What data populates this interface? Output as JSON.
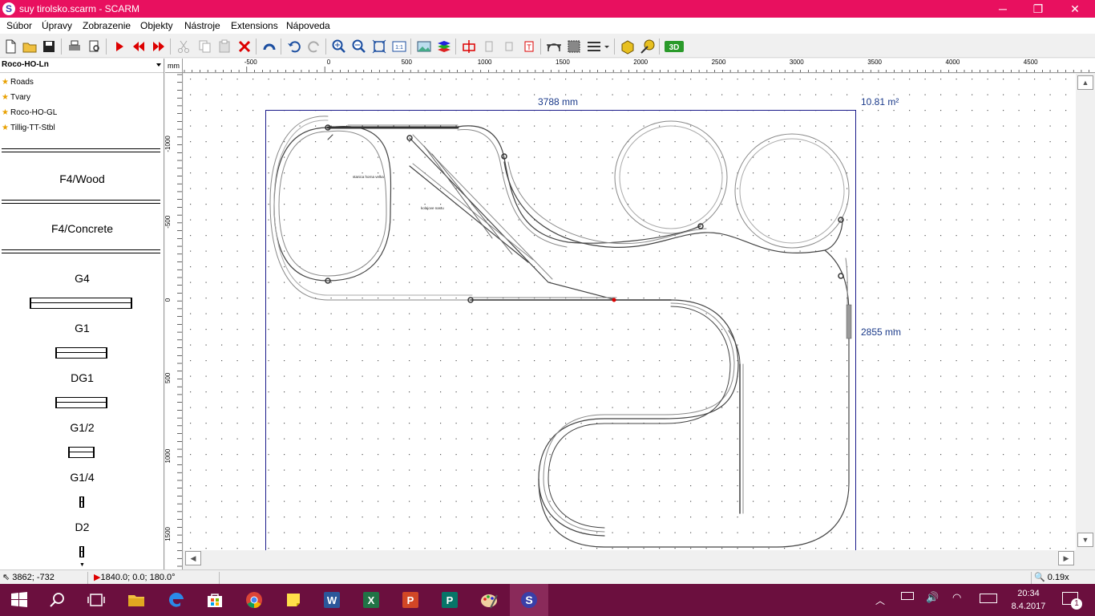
{
  "window": {
    "title": "suy tirolsko.scarm - SCARM",
    "app_icon_letter": "S",
    "controls": {
      "minimize": "─",
      "maximize": "❐",
      "close": "✕"
    }
  },
  "menu": [
    "Súbor",
    "Úpravy",
    "Zobrazenie",
    "Objekty",
    "Nástroje",
    "Extensions",
    "Nápoveda"
  ],
  "toolbar_icons": [
    "new-file-icon",
    "open-folder-icon",
    "save-icon",
    "print-icon",
    "print-preview-icon",
    "run-icon",
    "rewind-icon",
    "forward-icon",
    "cut-icon",
    "copy-icon",
    "paste-icon",
    "delete-icon",
    "rotate-icon",
    "undo-icon",
    "redo-icon",
    "zoom-in-icon",
    "zoom-out-icon",
    "zoom-fit-icon",
    "zoom-1to1-icon",
    "background-image-icon",
    "layers-icon",
    "elevation-icon",
    "flex-track-icon",
    "flex-track2-icon",
    "marker-icon",
    "bridge-icon",
    "tunnel-icon",
    "ruler-list-icon",
    "measure-icon",
    "tape-icon",
    "3d-view-icon"
  ],
  "toolbar_3d_label": "3D",
  "library": {
    "selected": "Roco-HO-Ln",
    "favorites": [
      "Roads",
      "Tvary",
      "Roco-HO-GL",
      "Tillig-TT-Stbl"
    ],
    "tracks": [
      {
        "label": "F4/Wood"
      },
      {
        "label": "F4/Concrete"
      },
      {
        "label": "G4"
      },
      {
        "label": "G1"
      },
      {
        "label": "DG1"
      },
      {
        "label": "G1/2"
      },
      {
        "label": "G1/4"
      },
      {
        "label": "D2"
      }
    ]
  },
  "ruler": {
    "unit": "mm",
    "h_ticks": [
      "-500",
      "0",
      "500",
      "1000",
      "1500",
      "2000",
      "2500",
      "3000",
      "3500",
      "4000",
      "4500"
    ],
    "v_ticks": [
      "-1000",
      "-500",
      "0",
      "500",
      "1000",
      "1500"
    ]
  },
  "board": {
    "width_label": "3788 mm",
    "height_label": "2855 mm",
    "area_label": "10.81 m²"
  },
  "layout_text": {
    "label_a": "stanica horna velka",
    "label_b": "kolajove nastu"
  },
  "status": {
    "cursor": "3862; -732",
    "selection": "1840.0; 0.0; 180.0°",
    "zoom": "0.19x"
  },
  "taskbar": {
    "apps": [
      "windows-start-icon",
      "search-icon",
      "task-view-icon",
      "file-explorer-icon",
      "edge-icon",
      "store-icon",
      "chrome-icon",
      "sticky-notes-icon",
      "word-icon",
      "excel-icon",
      "powerpoint-icon",
      "publisher-icon",
      "paint-icon",
      "scarm-icon"
    ],
    "time": "20:34",
    "date": "8.4.2017",
    "notification_count": "1"
  }
}
